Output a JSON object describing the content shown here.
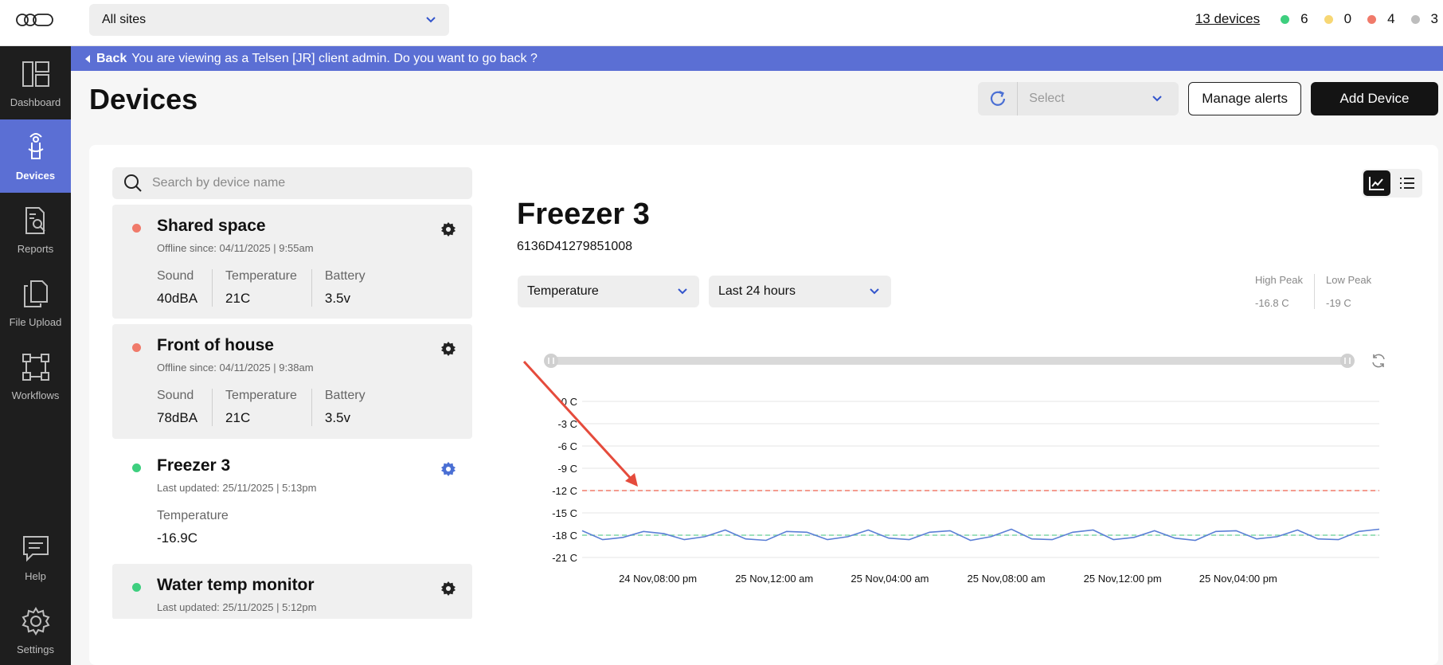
{
  "header": {
    "logo": "brand-logo-icon",
    "site_select": "All sites",
    "devices_link": "13 devices",
    "status_counts": [
      {
        "color": "#3ecf7f",
        "count": "6"
      },
      {
        "color": "#f7d774",
        "count": "0"
      },
      {
        "color": "#f07a6a",
        "count": "4"
      },
      {
        "color": "#bdbdbd",
        "count": "3"
      }
    ]
  },
  "sidebar": {
    "items": [
      {
        "label": "Dashboard",
        "icon": "dashboard-icon"
      },
      {
        "label": "Devices",
        "icon": "device-sensor-icon",
        "active": true
      },
      {
        "label": "Reports",
        "icon": "report-search-icon"
      },
      {
        "label": "File Upload",
        "icon": "files-icon"
      },
      {
        "label": "Workflows",
        "icon": "workflow-icon"
      },
      {
        "label": "Help",
        "icon": "help-chat-icon"
      },
      {
        "label": "Settings",
        "icon": "gear-icon"
      }
    ]
  },
  "banner": {
    "back": "Back",
    "message": "You are viewing as a Telsen [JR] client admin. Do you want to go back ?"
  },
  "page": {
    "title": "Devices",
    "select_placeholder": "Select",
    "manage_alerts": "Manage alerts",
    "add_device": "Add Device"
  },
  "search": {
    "placeholder": "Search by device name"
  },
  "devices": [
    {
      "name": "Shared space",
      "status": "Offline since: 04/11/2025 | 9:55am",
      "status_color": "#f07a6a",
      "metrics": [
        {
          "label": "Sound",
          "value": "40dBA"
        },
        {
          "label": "Temperature",
          "value": "21C"
        },
        {
          "label": "Battery",
          "value": "3.5v"
        }
      ]
    },
    {
      "name": "Front of house",
      "status": "Offline since: 04/11/2025 | 9:38am",
      "status_color": "#f07a6a",
      "metrics": [
        {
          "label": "Sound",
          "value": "78dBA"
        },
        {
          "label": "Temperature",
          "value": "21C"
        },
        {
          "label": "Battery",
          "value": "3.5v"
        }
      ]
    },
    {
      "name": "Freezer 3",
      "status": "Last updated: 25/11/2025 | 5:13pm",
      "status_color": "#3ecf7f",
      "metrics": [
        {
          "label": "Temperature",
          "value": "-16.9C"
        }
      ]
    },
    {
      "name": "Water temp monitor",
      "status": "Last updated: 25/11/2025 | 5:12pm",
      "status_color": "#3ecf7f"
    }
  ],
  "detail": {
    "title": "Freezer 3",
    "device_id": "6136D41279851008",
    "metric_select": "Temperature",
    "range_select": "Last 24 hours",
    "high_peak_label": "High Peak",
    "high_peak_value": "-16.8 C",
    "low_peak_label": "Low Peak",
    "low_peak_value": "-19 C"
  },
  "chart_data": {
    "type": "line",
    "y_ticks": [
      "0 C",
      "-3 C",
      "-6 C",
      "-9 C",
      "-12 C",
      "-15 C",
      "-18 C",
      "-21 C"
    ],
    "ylim": [
      -21,
      0
    ],
    "x_ticks": [
      "24 Nov,08:00 pm",
      "25 Nov,12:00 am",
      "25 Nov,04:00 am",
      "25 Nov,08:00 am",
      "25 Nov,12:00 pm",
      "25 Nov,04:00 pm"
    ],
    "threshold_high": -12,
    "threshold_low": -18,
    "series": [
      {
        "color": "#5b7fd6",
        "values": [
          -17.4,
          -18.6,
          -18.3,
          -17.5,
          -17.8,
          -18.6,
          -18.2,
          -17.3,
          -18.5,
          -18.7,
          -17.5,
          -17.6,
          -18.6,
          -18.2,
          -17.3,
          -18.4,
          -18.6,
          -17.6,
          -17.4,
          -18.7,
          -18.2,
          -17.2,
          -18.5,
          -18.6,
          -17.6,
          -17.3,
          -18.6,
          -18.3,
          -17.4,
          -18.4,
          -18.7,
          -17.5,
          -17.4,
          -18.5,
          -18.2,
          -17.3,
          -18.5,
          -18.6,
          -17.5,
          -17.2
        ]
      }
    ],
    "colors": {
      "grid": "#e6e6e6",
      "threshold_high": "#f07a6a",
      "threshold_low": "#7fd6a6",
      "annotation_arrow": "#e54b3c"
    }
  }
}
